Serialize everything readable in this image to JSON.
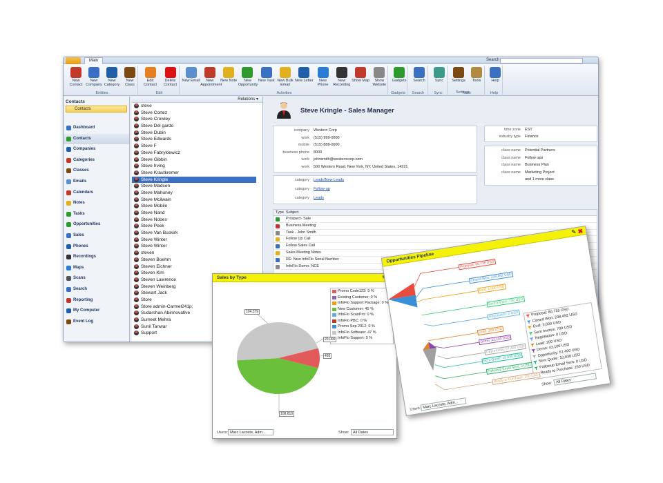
{
  "titlebar": {
    "tab": "Main",
    "search_label": "Search"
  },
  "ribbon": {
    "groups": [
      {
        "label": "Entities",
        "buttons": [
          "New Contact",
          "New Company",
          "New Category",
          "New Class"
        ]
      },
      {
        "label": "Edit",
        "buttons": [
          "Edit Contact",
          "Delete Contact"
        ]
      },
      {
        "label": "Activities",
        "buttons": [
          "New Email",
          "New Appointment",
          "New Note",
          "New Opportunity",
          "New Task",
          "New Bulk Email",
          "New Letter",
          "New Phone",
          "New Recording",
          "Show Map",
          "Show Website"
        ]
      },
      {
        "label": "Gadgets",
        "buttons": [
          "Gadgets"
        ]
      },
      {
        "label": "Search",
        "buttons": [
          "Search"
        ]
      },
      {
        "label": "Sync",
        "buttons": [
          "Sync"
        ]
      },
      {
        "label": "Tools",
        "buttons": [
          "Settings",
          "Tools"
        ]
      },
      {
        "label": "Settings",
        "buttons": []
      },
      {
        "label": "Help",
        "buttons": [
          "Help"
        ]
      }
    ]
  },
  "nav": {
    "header": "Contacts",
    "selected": "Contacts",
    "items": [
      "Dashboard",
      "Contacts",
      "Companies",
      "Categories",
      "Classes",
      "Emails",
      "Calendars",
      "Notes",
      "Tasks",
      "Opportunities",
      "Sales",
      "Phones",
      "Recordings",
      "Maps",
      "Scans",
      "Search",
      "Reporting",
      "My Computer",
      "Event Log"
    ]
  },
  "list": {
    "relations_label": "Relations ▾",
    "contacts": [
      "steve",
      "Steve Cortez",
      "Steve Crowley",
      "Steve Del gardo",
      "Steve Dubin",
      "Steve Edwards",
      "Steve F",
      "Steve Fabrykiewicz",
      "Steve Gibbin",
      "Steve Irving",
      "Steve Krautkremer",
      "Steve Kringle",
      "Steve Madsen",
      "Steve Mahoney",
      "Steve Mcilwain",
      "Steve Mobile",
      "Steve Nand",
      "Steve Nobes",
      "Steve Peek",
      "Steve Van Buskirk",
      "Steve Winter",
      "Steve Winter",
      "steven",
      "Steven Boehm",
      "Steven Eichner",
      "Steven Kim",
      "Steven Lawrence",
      "Steven Weinberg",
      "Stewart Jack",
      "Store",
      "Store admin-Carmel241p;",
      "Sudarshan Abinnovative",
      "Sumeet Mehra",
      "Sunil Tanwar",
      "Support"
    ],
    "selected_index": 11
  },
  "detail": {
    "title": "Steve Kringle - Sales Manager",
    "info": [
      {
        "k": "company",
        "v": "Western Corp"
      },
      {
        "k": "work",
        "v": "(515) 999-0000"
      },
      {
        "k": "mobile",
        "v": "(515) 888-0000"
      },
      {
        "k": "business phone",
        "v": "8000"
      },
      {
        "k": "work",
        "v": "johnsmith@westerncorp.com"
      },
      {
        "k": "work",
        "v": "500 Western Road, New York, NY, United States, 14221"
      }
    ],
    "meta": [
      {
        "k": "time zone",
        "v": "EST"
      },
      {
        "k": "industry type",
        "v": "Finance"
      }
    ],
    "categories": [
      {
        "k": "category",
        "v": "Leads\\New Leads"
      },
      {
        "k": "category",
        "v": "Follow-up"
      },
      {
        "k": "category",
        "v": "Leads"
      }
    ],
    "classes": [
      {
        "k": "class name",
        "v": "Potential Partners"
      },
      {
        "k": "class name",
        "v": "Follow ups"
      },
      {
        "k": "class name",
        "v": "Business Plan"
      },
      {
        "k": "class name",
        "v": "Marketing Project"
      },
      {
        "k": "",
        "v": "and 1 more class"
      }
    ],
    "table": {
      "col_type": "Type",
      "col_subject": "Subject",
      "rows": [
        {
          "subject": "Prospect- Sale",
          "color": "#2e9a2e"
        },
        {
          "subject": "Business Meeting",
          "color": "#c33"
        },
        {
          "subject": "Task - John Smith",
          "color": "#888"
        },
        {
          "subject": "Follow Up Call",
          "color": "#e0b020"
        },
        {
          "subject": "Follow Sales Call",
          "color": "#3a6fc0"
        },
        {
          "subject": "Sales Meeting Notes",
          "color": "#e0b020"
        },
        {
          "subject": "RE: New InfoFlo Serial Number",
          "color": "#3a6fc0"
        },
        {
          "subject": "InfoFlo Demo- NCE",
          "color": "#888"
        }
      ]
    }
  },
  "sales_widget": {
    "title": "Sales by Type",
    "users_label": "Users:",
    "users_value": "Marc Lacoste, Adm...",
    "show_label": "Show:",
    "show_value": "All Dates",
    "colors": {
      "Promo Code123": "#e25a5a",
      "Existing Customer": "#9b59b6",
      "InfoFlo Support Package": "#f39c12",
      "New Customer": "#6abf3b",
      "InfoFlo ScanPro": "#5dade2",
      "InfoFlo PBC": "#c0392b",
      "Promo Sep 2012": "#3b8fd6",
      "InfoFlo Software": "#c8c8c8",
      "InfoFlo Support": "#8a8a8a"
    }
  },
  "pipeline_widget": {
    "title": "Opportunities Pipeline",
    "users_label": "Users:",
    "users_value": "Marc Lacoste, Adm...",
    "show_label": "Show:",
    "show_value": "All Dates",
    "stages": [
      {
        "label": "Proposal: 60,716 USD",
        "value": 60716,
        "color": "#e74c3c"
      },
      {
        "label": "Closed Won: 238,492 USD",
        "value": 238492,
        "color": "#3b8fd6"
      },
      {
        "label": "Eval: 3,000 USD",
        "value": 3000,
        "color": "#f39c12"
      },
      {
        "label": "Sent Invoice: 700 USD",
        "value": 700,
        "color": "#2ecc71"
      },
      {
        "label": "Negotiation: 0 USD",
        "value": 0,
        "color": "#5dade2"
      },
      {
        "label": "Lead: 200 USD",
        "value": 200,
        "color": "#e67e22"
      },
      {
        "label": "Demo: 43,100 USD",
        "value": 43100,
        "color": "#8e44ad"
      },
      {
        "label": "Opportunity: 57,400 USD",
        "value": 57400,
        "color": "#a0a0a0"
      },
      {
        "label": "Sent Quote: 10,038 USD",
        "value": 10038,
        "color": "#1abc9c"
      },
      {
        "label": "Followup Email Sent: 0 USD",
        "value": 0,
        "color": "#27ae60"
      },
      {
        "label": "Ready to Purchase: 250 USD",
        "value": 250,
        "color": "#d4a373"
      }
    ]
  },
  "chart_data": {
    "type": "pie",
    "title": "Sales by Type",
    "categories": [
      "Promo Code123",
      "Existing Customer",
      "InfoFlo Support Package",
      "New Customer",
      "InfoFlo ScanPro",
      "InfoFlo PBC",
      "Promo Sep 2012",
      "InfoFlo Software",
      "InfoFlo Support"
    ],
    "percents": [
      9,
      0,
      0,
      45,
      0,
      0,
      0,
      47,
      0
    ],
    "legend_labels": [
      "Promo Code123: 9 %",
      "Existing Customer: 0 %",
      "InfoFlo Support Package: 0 %",
      "New Customer: 45 %",
      "InfoFlo ScanPro: 0 %",
      "InfoFlo PBC: 0 %",
      "Promo Sep 2012: 0 %",
      "InfoFlo Software: 47 %",
      "InfoFlo Support: 0 %"
    ],
    "slice_callouts": [
      "20,000",
      "104,379",
      "108,610",
      "495"
    ],
    "legend_placement": "right"
  }
}
